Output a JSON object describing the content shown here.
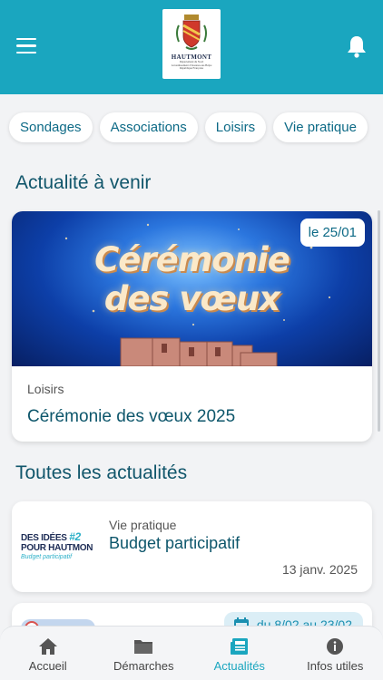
{
  "header": {
    "logo_name": "HAUTMONT",
    "logo_sub_lines": [
      "Département du Nord",
      "Arrondissement d'Avesnes-sur-Helpe",
      "République Française"
    ]
  },
  "categories": [
    "Sondages",
    "Associations",
    "Loisirs",
    "Vie pratique"
  ],
  "upcoming": {
    "section_title": "Actualité à venir",
    "hero_line1": "Cérémonie",
    "hero_line2": "des vœux",
    "date_badge": "le 25/01",
    "category": "Loisirs",
    "title": "Cérémonie des vœux 2025"
  },
  "all_news": {
    "section_title": "Toutes les actualités",
    "items": [
      {
        "thumb_line1": "DES IDÉES",
        "thumb_num": "#2",
        "thumb_line2": "POUR HAUTMON",
        "thumb_line3": "Budget participatif",
        "category": "Vie pratique",
        "title": "Budget participatif",
        "date": "13 janv. 2025"
      },
      {
        "date_range": "du 8/02 au 23/02"
      }
    ]
  },
  "nav": {
    "items": [
      {
        "label": "Accueil",
        "icon": "home-icon"
      },
      {
        "label": "Démarches",
        "icon": "folder-icon"
      },
      {
        "label": "Actualités",
        "icon": "newspaper-icon"
      },
      {
        "label": "Infos utiles",
        "icon": "info-icon"
      }
    ],
    "active": "Actualités"
  },
  "colors": {
    "header": "#1aa6bf",
    "accent": "#1aa6bf",
    "title": "#11566b"
  }
}
